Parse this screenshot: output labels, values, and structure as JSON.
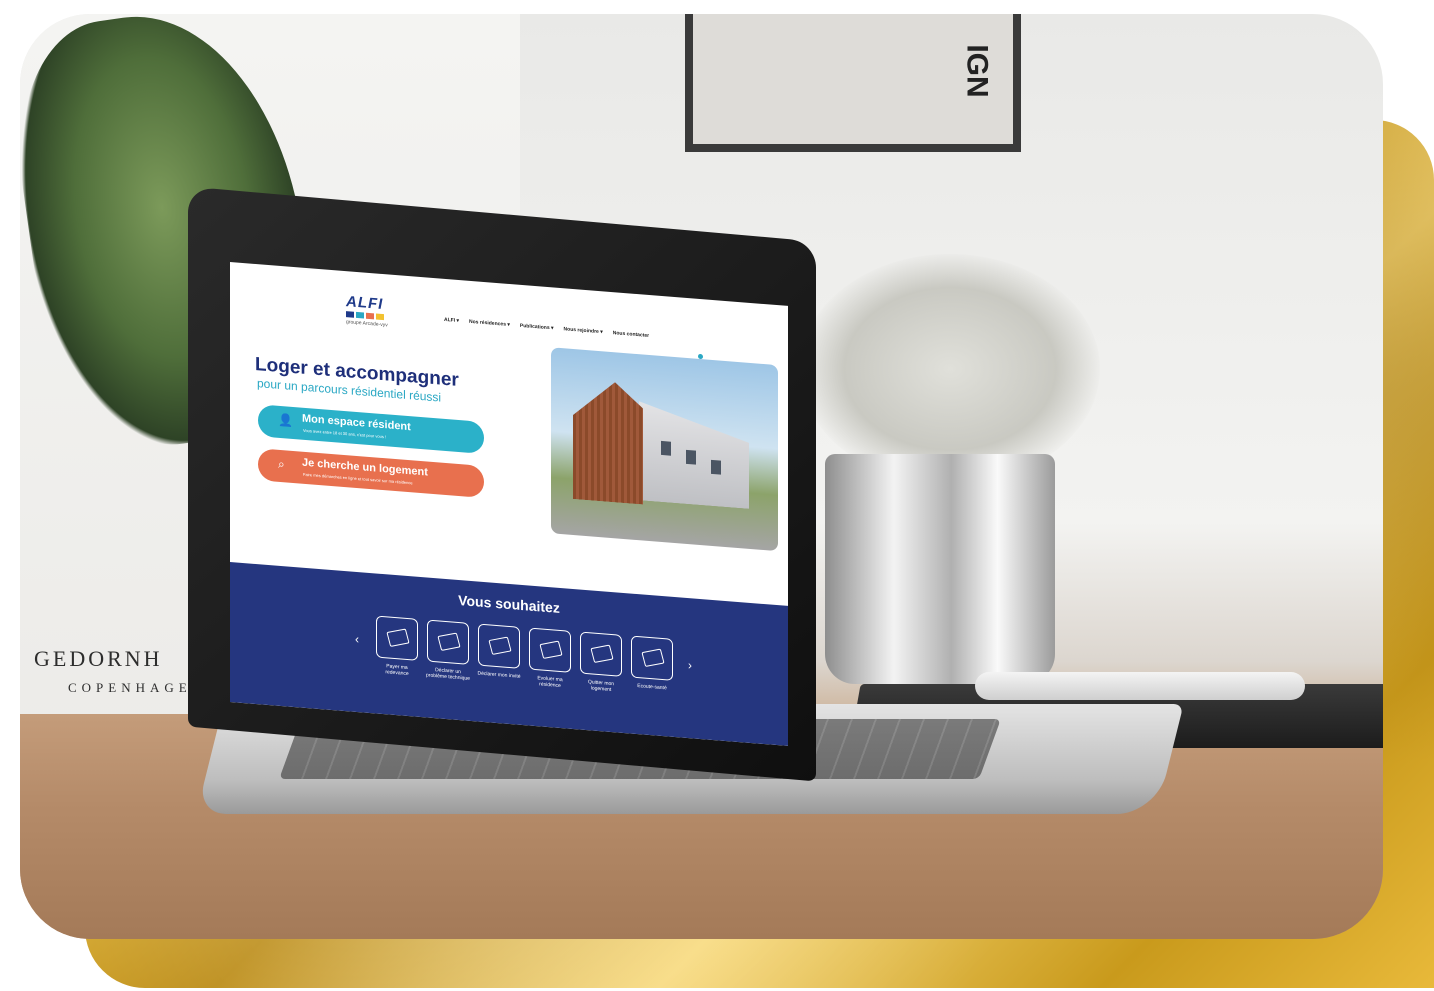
{
  "background": {
    "poster_line1": "GEDORNH",
    "poster_line2": "COPENHAGEN",
    "frame_text": "IGN"
  },
  "site": {
    "logo": {
      "word": "ALFI",
      "subtitle": "groupe Arcade-vyv",
      "colors": [
        "#1f3a8a",
        "#2ba8c4",
        "#e8704e",
        "#f2c230"
      ]
    },
    "nav": [
      "ALFI ▾",
      "Nos résidences ▾",
      "Publications ▾",
      "Nous rejoindre ▾",
      "Nous contacter"
    ],
    "hero": {
      "title": "Loger et accompagner",
      "subtitle": "pour un parcours résidentiel réussi"
    },
    "cta_resident": {
      "icon": "user-icon",
      "label": "Mon espace résident",
      "sub": "Vous avez entre 18 et 30 ans, c'est pour vous !"
    },
    "cta_search": {
      "icon": "search-icon",
      "label": "Je cherche un logement",
      "sub": "Faire mes démarches en ligne et tout savoir sur ma résidence"
    },
    "section": {
      "title": "Vous souhaitez",
      "prev": "‹",
      "next": "›",
      "tiles": [
        {
          "label": "Payer ma redevance"
        },
        {
          "label": "Déclarer un problème technique"
        },
        {
          "label": "Déclarer mon invité"
        },
        {
          "label": "Evoluer ma résidence"
        },
        {
          "label": "Quitter mon logement"
        },
        {
          "label": "Ecoute-santé"
        }
      ]
    },
    "colors": {
      "navy": "#25367f",
      "teal": "#2bb1c9",
      "orange": "#e8704e"
    }
  }
}
